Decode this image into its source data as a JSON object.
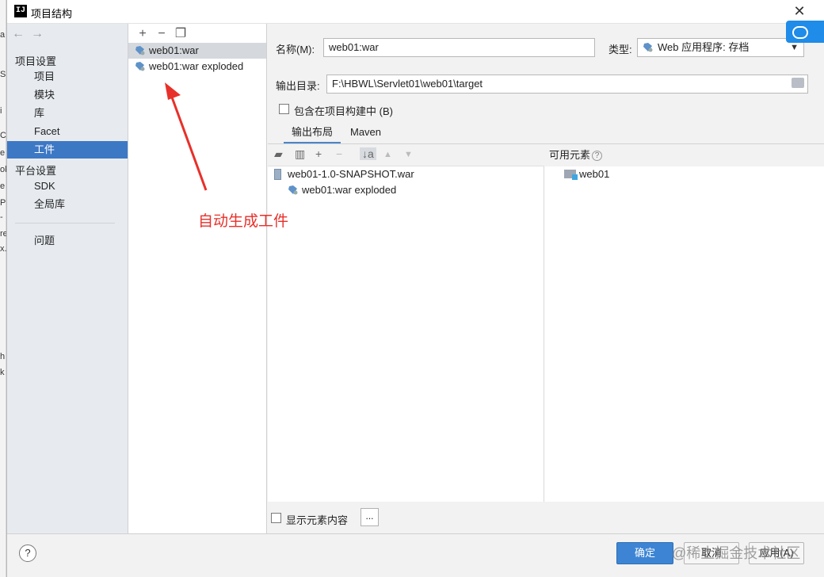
{
  "window": {
    "title": "项目结构",
    "app_icon": "IJ"
  },
  "background_strip": [
    "a",
    "S",
    "i",
    "C",
    "e",
    "ok",
    "e",
    "P",
    "-",
    "re",
    "x.",
    "h",
    "k"
  ],
  "nav": {
    "project_settings": "项目设置",
    "items_project": [
      {
        "label": "项目",
        "selected": false
      },
      {
        "label": "模块",
        "selected": false
      },
      {
        "label": "库",
        "selected": false
      },
      {
        "label": "Facet",
        "selected": false
      },
      {
        "label": "工件",
        "selected": true
      }
    ],
    "platform_settings": "平台设置",
    "items_platform": [
      {
        "label": "SDK"
      },
      {
        "label": "全局库"
      }
    ],
    "problems": "问题"
  },
  "artifacts": [
    {
      "label": "web01:war",
      "selected": true
    },
    {
      "label": "web01:war exploded",
      "selected": false
    }
  ],
  "annotation": "自动生成工件",
  "form": {
    "name_label": "名称(M):",
    "name_value": "web01:war",
    "type_label": "类型:",
    "type_value": "Web 应用程序: 存档",
    "output_label": "输出目录:",
    "output_value": "F:\\HBWL\\Servlet01\\web01\\target",
    "include_label": "包含在项目构建中 (B)",
    "include_checked": false
  },
  "tabs": [
    {
      "label": "输出布局",
      "active": true
    },
    {
      "label": "Maven",
      "active": false
    }
  ],
  "output_tree": [
    {
      "label": "web01-1.0-SNAPSHOT.war",
      "icon": "archive-icon",
      "level": 0
    },
    {
      "label": "web01:war exploded",
      "icon": "artifact-icon",
      "level": 1
    }
  ],
  "available": {
    "header": "可用元素",
    "help": "?",
    "items": [
      {
        "label": "web01",
        "icon": "module-folder-icon"
      }
    ]
  },
  "show_content": {
    "label": "显示元素内容",
    "checked": false,
    "button": "..."
  },
  "buttons": {
    "ok": "确定",
    "cancel": "取消",
    "apply": "应用(A)"
  },
  "watermark": "@稀土掘金技术社区",
  "colors": {
    "selection": "#3d78c5",
    "accent_button": "#3d85d4",
    "annotation": "#e8302a"
  }
}
